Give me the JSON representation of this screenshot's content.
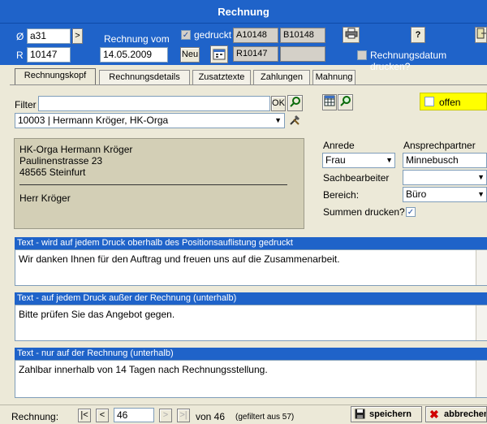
{
  "window": {
    "title": "Rechnung"
  },
  "header": {
    "o_label": "Ø",
    "r_label": "R",
    "o_value": "a31",
    "r_value": "10147",
    "rechnung_vom_label": "Rechnung vom",
    "rechnung_vom_value": "14.05.2009",
    "gedruckt_label": "gedruckt",
    "gedruckt_checked": "✓",
    "neu_label": "Neu",
    "ref1": "A10148",
    "ref2": "B10148",
    "ref3": "R10147",
    "arrow_label": ">",
    "help_label": "?",
    "datum_drucken_label": "Rechnungsdatum drucken?"
  },
  "tabs": [
    {
      "label": "Rechnungskopf"
    },
    {
      "label": "Rechnungsdetails"
    },
    {
      "label": "Zusatztexte"
    },
    {
      "label": "Zahlungen"
    },
    {
      "label": "Mahnung"
    }
  ],
  "filter": {
    "label": "Filter",
    "value": "",
    "ok_label": "OK",
    "selected_customer": "10003 | Hermann Kröger, HK-Orga"
  },
  "status": {
    "offen_label": "offen"
  },
  "address": {
    "lines": [
      "HK-Orga Hermann Kröger",
      "Paulinenstrasse 23",
      "48565 Steinfurt"
    ],
    "salutation": "Herr Kröger"
  },
  "right": {
    "anrede_label": "Anrede",
    "anrede_value": "Frau",
    "ansprechpartner_label": "Ansprechpartner",
    "ansprechpartner_value": "Minnebusch",
    "sachbearbeiter_label": "Sachbearbeiter",
    "sachbearbeiter_value": "",
    "bereich_label": "Bereich:",
    "bereich_value": "Büro",
    "summen_label": "Summen drucken?",
    "summen_checked": "✓"
  },
  "texts": [
    {
      "title": "Text - wird auf jedem Druck oberhalb des Positionsauflistung gedruckt",
      "content": "Wir danken Ihnen für den Auftrag und freuen uns auf die Zusammenarbeit."
    },
    {
      "title": "Text - auf jedem Druck außer der Rechnung (unterhalb)",
      "content": "Bitte prüfen Sie das Angebot gegen."
    },
    {
      "title": "Text - nur auf der Rechnung (unterhalb)",
      "content": "Zahlbar innerhalb von 14 Tagen nach Rechnungsstellung."
    }
  ],
  "nav": {
    "label": "Rechnung:",
    "first": "|<",
    "prev": "<",
    "current": "46",
    "next": ">",
    "last": ">|",
    "of_text": "von 46",
    "filtered_text": "(gefiltert aus 57)",
    "save_label": "speichern",
    "cancel_label": "abbrechen"
  },
  "colors": {
    "title_bar": "#1f63c9",
    "offen": "#ffff00",
    "address_bg": "#d3cfb6"
  }
}
